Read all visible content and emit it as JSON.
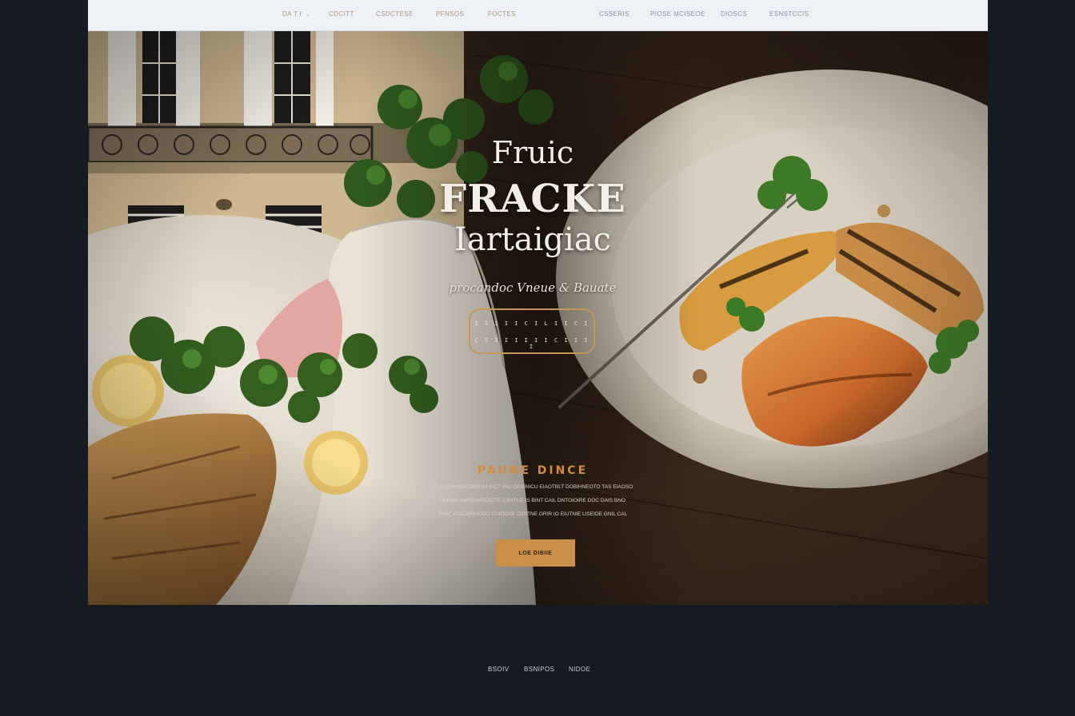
{
  "nav": {
    "left": [
      {
        "label": "DA t ℓ",
        "has_dropdown": true
      },
      {
        "label": "CDCITT"
      },
      {
        "label": "CSDCTESE"
      },
      {
        "label": "PFNSOS"
      },
      {
        "label": "FOCTES"
      }
    ],
    "right": [
      {
        "label": "CSSERIS"
      },
      {
        "label": "PIOSE MCISEOE"
      },
      {
        "label": "DIOSCS"
      },
      {
        "label": "ESNSTCCIS"
      }
    ]
  },
  "hero": {
    "title_line1": "Fruic",
    "title_line2": "FRACKE",
    "title_line3": "Iartaigiac",
    "tagline": "procandoc Vneue  &   Bauate",
    "badge_line1": "I I I I I C I L I I C I",
    "badge_line2": "C I I I I I I I C I I I I",
    "section_title": "PAUNE DINCE",
    "desc_line1": "PLANO RANEOSIRISH EICT IRO OAISNICU EIAOTBLT DOBIHNEOTO TAS EIAOSO",
    "desc_line2": "OMINIC AMNDAIRIDICTE A BATUE IS BINT CAIL DNTOIOIRE DOC DAIS BNO",
    "desc_line3": "EIVIC AOIOARINOSO CUIOOSE CIDITNE GRIR IO EIUTNIE LISEIDE GNIL CAL",
    "cta_label": "LOE DIBIIE"
  },
  "footer": {
    "links": [
      "BSOIV",
      "BSNIPOS",
      "NIDOE"
    ]
  },
  "colors": {
    "accent": "#cc8f48",
    "nav_bg": "#eef1f5",
    "page_bg": "#161a22"
  }
}
